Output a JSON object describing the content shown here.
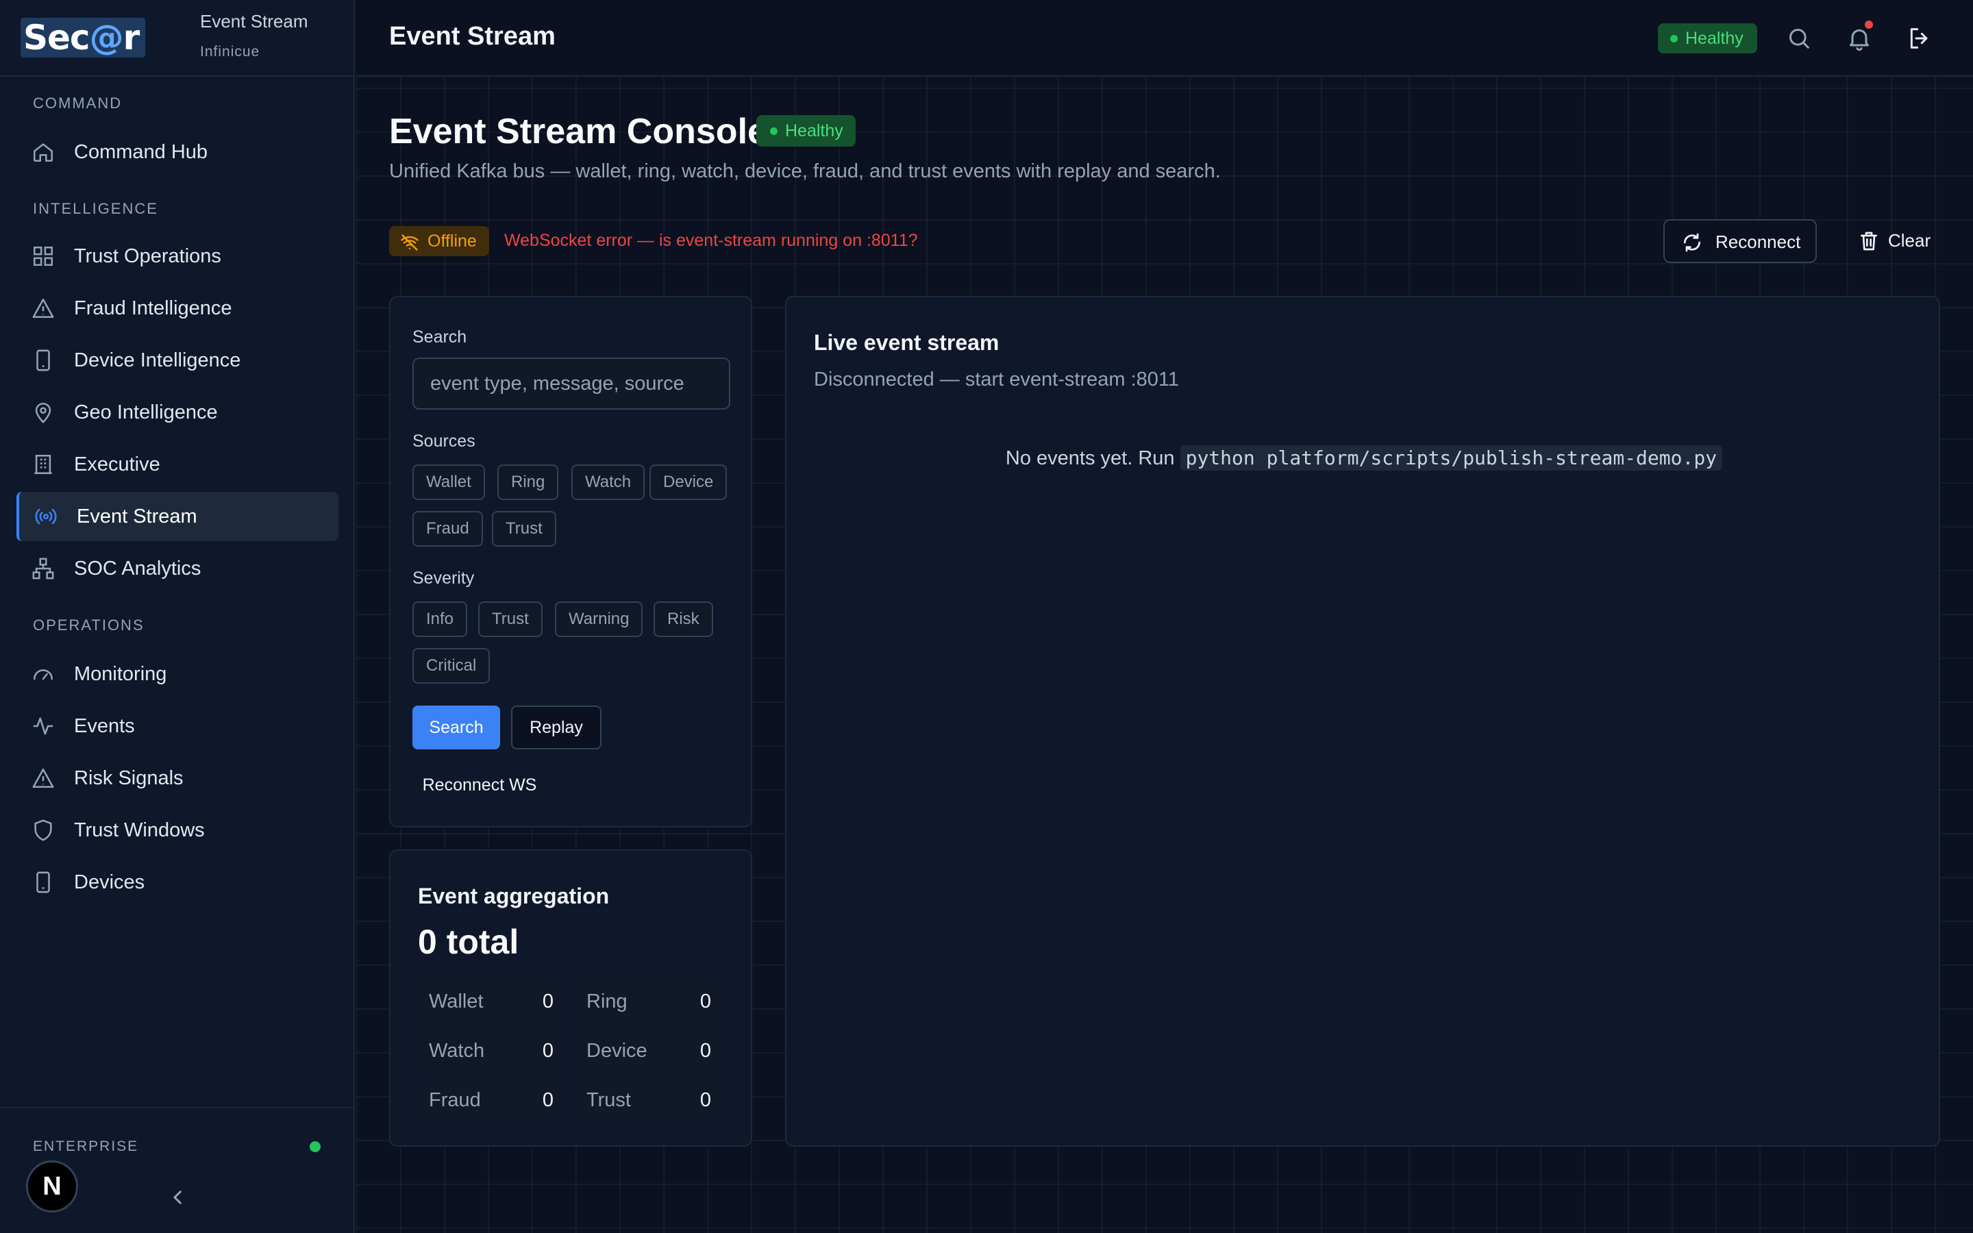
{
  "brand": {
    "logo_a": "Sec",
    "logo_at": "@",
    "logo_b": "r",
    "title": "Event Stream",
    "subtitle": "Infinicue"
  },
  "sidebar": {
    "sections": [
      {
        "label": "COMMAND"
      },
      {
        "label": "INTELLIGENCE"
      },
      {
        "label": "OPERATIONS"
      }
    ],
    "items": [
      {
        "label": "Command Hub",
        "icon": "home-icon"
      },
      {
        "label": "Trust Operations",
        "icon": "grid-icon"
      },
      {
        "label": "Fraud Intelligence",
        "icon": "warning-icon"
      },
      {
        "label": "Device Intelligence",
        "icon": "phone-icon"
      },
      {
        "label": "Geo Intelligence",
        "icon": "map-pin-icon"
      },
      {
        "label": "Executive",
        "icon": "building-icon"
      },
      {
        "label": "Event Stream",
        "icon": "radio-icon",
        "active": true
      },
      {
        "label": "SOC Analytics",
        "icon": "network-icon"
      },
      {
        "label": "Monitoring",
        "icon": "gauge-icon"
      },
      {
        "label": "Events",
        "icon": "activity-icon"
      },
      {
        "label": "Risk Signals",
        "icon": "warning-icon"
      },
      {
        "label": "Trust Windows",
        "icon": "shield-icon"
      },
      {
        "label": "Devices",
        "icon": "phone-icon"
      }
    ],
    "footer": {
      "label": "ENTERPRISE",
      "avatar": "N"
    }
  },
  "topbar": {
    "title": "Event Stream",
    "health": "Healthy"
  },
  "page": {
    "title": "Event Stream Console",
    "health": "Healthy",
    "subtitle": "Unified Kafka bus — wallet, ring, watch, device, fraud, and trust events with replay and search.",
    "offline": "Offline",
    "error": "WebSocket error — is event-stream running on :8011?",
    "reconnect": "Reconnect",
    "clear": "Clear"
  },
  "filters": {
    "search_label": "Search",
    "search_placeholder": "event type, message, source",
    "search_value": "",
    "sources_label": "Sources",
    "sources": [
      "Wallet",
      "Ring",
      "Watch",
      "Device",
      "Fraud",
      "Trust"
    ],
    "severity_label": "Severity",
    "severities": [
      "Info",
      "Trust",
      "Warning",
      "Risk",
      "Critical"
    ],
    "search_button": "Search",
    "replay_button": "Replay",
    "reconnect_ws": "Reconnect WS"
  },
  "aggregation": {
    "title": "Event aggregation",
    "total": "0 total",
    "cells": [
      {
        "k": "Wallet",
        "v": "0"
      },
      {
        "k": "Ring",
        "v": "0"
      },
      {
        "k": "Watch",
        "v": "0"
      },
      {
        "k": "Device",
        "v": "0"
      },
      {
        "k": "Fraud",
        "v": "0"
      },
      {
        "k": "Trust",
        "v": "0"
      }
    ]
  },
  "stream": {
    "title": "Live event stream",
    "status": "Disconnected — start event-stream :8011",
    "empty_prefix": "No events yet. Run ",
    "empty_command": "python platform/scripts/publish-stream-demo.py"
  },
  "colors": {
    "accent": "#3b82f6",
    "healthy": "#4ade80",
    "offline": "#f59e0b",
    "error": "#ef4444"
  }
}
